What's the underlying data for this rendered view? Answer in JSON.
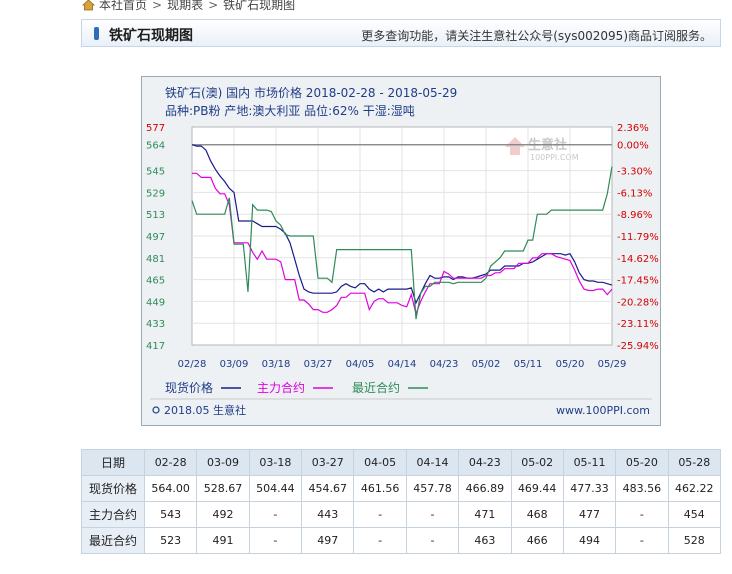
{
  "breadcrumb": [
    "本社首页",
    "现期表",
    "铁矿石现期图"
  ],
  "page_title": "铁矿石现期图",
  "notice": "更多查询功能，请关注生意社公众号(sys002095)商品订阅服务。",
  "chart_data": {
    "type": "line",
    "title": "铁矿石(澳) 国内 市场价格 2018-02-28 - 2018-05-29",
    "subtitle": "品种:PB粉 产地:澳大利亚 品位:62% 干湿:湿吨",
    "watermark_cn": "生意社",
    "watermark_url": "100PPI.COM",
    "footer_left": "2018.05 生意社",
    "footer_right": "www.100PPI.com",
    "grid": true,
    "legend_position": "bottom",
    "ylim": [
      417,
      577
    ],
    "left_ticks": [
      "577",
      "564",
      "545",
      "529",
      "513",
      "497",
      "481",
      "465",
      "449",
      "433",
      "417"
    ],
    "left_tick_values": [
      577,
      564,
      545,
      529,
      513,
      497,
      481,
      465,
      449,
      433,
      417
    ],
    "right_ticks": [
      "2.36%",
      "0.00%",
      "-3.30%",
      "-6.13%",
      "-8.96%",
      "-11.79%",
      "-14.62%",
      "-17.45%",
      "-20.28%",
      "-23.11%",
      "-25.94%"
    ],
    "x_ticks": [
      "02/28",
      "03/09",
      "03/18",
      "03/27",
      "04/05",
      "04/14",
      "04/23",
      "05/02",
      "05/11",
      "05/20",
      "05/29"
    ],
    "x_range": [
      "2018-02-28",
      "2018-05-29"
    ],
    "baseline_value": 564,
    "colors": {
      "spot": "#1a1a8c",
      "main": "#e000e0",
      "recent": "#2e8b57",
      "baseline": "#7d7d7d",
      "top_tick": "#d40000",
      "right_axis": "#d40000"
    },
    "series": [
      {
        "name": "现货价格",
        "color": "#1a1a8c",
        "points": [
          [
            "02-28",
            564
          ],
          [
            "03-01",
            563
          ],
          [
            "03-02",
            563
          ],
          [
            "03-03",
            560
          ],
          [
            "03-04",
            552
          ],
          [
            "03-05",
            546
          ],
          [
            "03-06",
            541
          ],
          [
            "03-07",
            537
          ],
          [
            "03-08",
            532
          ],
          [
            "03-09",
            529
          ],
          [
            "03-10",
            508
          ],
          [
            "03-11",
            508
          ],
          [
            "03-12",
            508
          ],
          [
            "03-13",
            508
          ],
          [
            "03-14",
            506
          ],
          [
            "03-15",
            504
          ],
          [
            "03-16",
            504
          ],
          [
            "03-17",
            504
          ],
          [
            "03-18",
            504
          ],
          [
            "03-19",
            502
          ],
          [
            "03-20",
            499
          ],
          [
            "03-21",
            492
          ],
          [
            "03-22",
            480
          ],
          [
            "03-23",
            468
          ],
          [
            "03-24",
            458
          ],
          [
            "03-25",
            456
          ],
          [
            "03-26",
            455
          ],
          [
            "03-27",
            455
          ],
          [
            "03-28",
            455
          ],
          [
            "03-29",
            455
          ],
          [
            "03-30",
            455
          ],
          [
            "03-31",
            456
          ],
          [
            "04-01",
            460
          ],
          [
            "04-02",
            462
          ],
          [
            "04-03",
            460
          ],
          [
            "04-04",
            459
          ],
          [
            "04-05",
            462
          ],
          [
            "04-06",
            462
          ],
          [
            "04-07",
            458
          ],
          [
            "04-08",
            456
          ],
          [
            "04-09",
            458
          ],
          [
            "04-10",
            456
          ],
          [
            "04-11",
            458
          ],
          [
            "04-12",
            458
          ],
          [
            "04-13",
            458
          ],
          [
            "04-14",
            458
          ],
          [
            "04-15",
            458
          ],
          [
            "04-16",
            459
          ],
          [
            "04-17",
            448
          ],
          [
            "04-18",
            455
          ],
          [
            "04-19",
            462
          ],
          [
            "04-20",
            468
          ],
          [
            "04-21",
            466
          ],
          [
            "04-22",
            466
          ],
          [
            "04-23",
            467
          ],
          [
            "04-24",
            467
          ],
          [
            "04-25",
            465
          ],
          [
            "04-26",
            467
          ],
          [
            "04-27",
            467
          ],
          [
            "04-28",
            466
          ],
          [
            "04-29",
            466
          ],
          [
            "04-30",
            467
          ],
          [
            "05-01",
            468
          ],
          [
            "05-02",
            469
          ],
          [
            "05-03",
            472
          ],
          [
            "05-04",
            472
          ],
          [
            "05-05",
            472
          ],
          [
            "05-06",
            475
          ],
          [
            "05-07",
            475
          ],
          [
            "05-08",
            475
          ],
          [
            "05-09",
            475
          ],
          [
            "05-10",
            477
          ],
          [
            "05-11",
            477
          ],
          [
            "05-12",
            478
          ],
          [
            "05-13",
            480
          ],
          [
            "05-14",
            482
          ],
          [
            "05-15",
            484
          ],
          [
            "05-16",
            484
          ],
          [
            "05-17",
            484
          ],
          [
            "05-18",
            484
          ],
          [
            "05-19",
            483
          ],
          [
            "05-20",
            484
          ],
          [
            "05-21",
            478
          ],
          [
            "05-22",
            470
          ],
          [
            "05-23",
            465
          ],
          [
            "05-24",
            464
          ],
          [
            "05-25",
            464
          ],
          [
            "05-26",
            463
          ],
          [
            "05-27",
            463
          ],
          [
            "05-28",
            462
          ],
          [
            "05-29",
            461
          ]
        ]
      },
      {
        "name": "主力合约",
        "color": "#e000e0",
        "points": [
          [
            "02-28",
            543
          ],
          [
            "03-01",
            543
          ],
          [
            "03-02",
            540
          ],
          [
            "03-03",
            540
          ],
          [
            "03-04",
            540
          ],
          [
            "03-05",
            532
          ],
          [
            "03-06",
            528
          ],
          [
            "03-07",
            528
          ],
          [
            "03-08",
            520
          ],
          [
            "03-09",
            492
          ],
          [
            "03-10",
            492
          ],
          [
            "03-11",
            492
          ],
          [
            "03-12",
            492
          ],
          [
            "03-13",
            485
          ],
          [
            "03-14",
            480
          ],
          [
            "03-15",
            486
          ],
          [
            "03-16",
            480
          ],
          [
            "03-17",
            480
          ],
          [
            "03-18",
            480
          ],
          [
            "03-19",
            478
          ],
          [
            "03-20",
            465
          ],
          [
            "03-21",
            465
          ],
          [
            "03-22",
            465
          ],
          [
            "03-23",
            450
          ],
          [
            "03-24",
            450
          ],
          [
            "03-25",
            447
          ],
          [
            "03-26",
            443
          ],
          [
            "03-27",
            443
          ],
          [
            "03-28",
            441
          ],
          [
            "03-29",
            441
          ],
          [
            "03-30",
            443
          ],
          [
            "03-31",
            446
          ],
          [
            "04-01",
            452
          ],
          [
            "04-02",
            452
          ],
          [
            "04-03",
            455
          ],
          [
            "04-04",
            455
          ],
          [
            "04-05",
            455
          ],
          [
            "04-06",
            455
          ],
          [
            "04-07",
            443
          ],
          [
            "04-08",
            449
          ],
          [
            "04-09",
            451
          ],
          [
            "04-10",
            451
          ],
          [
            "04-11",
            448
          ],
          [
            "04-12",
            448
          ],
          [
            "04-13",
            448
          ],
          [
            "04-14",
            446
          ],
          [
            "04-15",
            445
          ],
          [
            "04-16",
            454
          ],
          [
            "04-17",
            440
          ],
          [
            "04-18",
            449
          ],
          [
            "04-19",
            456
          ],
          [
            "04-20",
            462
          ],
          [
            "04-21",
            462
          ],
          [
            "04-22",
            462
          ],
          [
            "04-23",
            471
          ],
          [
            "04-24",
            469
          ],
          [
            "04-25",
            466
          ],
          [
            "04-26",
            466
          ],
          [
            "04-27",
            466
          ],
          [
            "04-28",
            466
          ],
          [
            "04-29",
            466
          ],
          [
            "04-30",
            466
          ],
          [
            "05-01",
            466
          ],
          [
            "05-02",
            468
          ],
          [
            "05-03",
            468
          ],
          [
            "05-04",
            470
          ],
          [
            "05-05",
            470
          ],
          [
            "05-06",
            473
          ],
          [
            "05-07",
            473
          ],
          [
            "05-08",
            473
          ],
          [
            "05-09",
            477
          ],
          [
            "05-10",
            477
          ],
          [
            "05-11",
            477
          ],
          [
            "05-12",
            481
          ],
          [
            "05-13",
            481
          ],
          [
            "05-14",
            484
          ],
          [
            "05-15",
            484
          ],
          [
            "05-16",
            484
          ],
          [
            "05-17",
            482
          ],
          [
            "05-18",
            481
          ],
          [
            "05-19",
            480
          ],
          [
            "05-20",
            479
          ],
          [
            "05-21",
            472
          ],
          [
            "05-22",
            464
          ],
          [
            "05-23",
            458
          ],
          [
            "05-24",
            457
          ],
          [
            "05-25",
            457
          ],
          [
            "05-26",
            458
          ],
          [
            "05-27",
            458
          ],
          [
            "05-28",
            454
          ],
          [
            "05-29",
            458
          ]
        ]
      },
      {
        "name": "最近合约",
        "color": "#2e8b57",
        "points": [
          [
            "02-28",
            523
          ],
          [
            "03-01",
            513
          ],
          [
            "03-02",
            513
          ],
          [
            "03-03",
            513
          ],
          [
            "03-04",
            513
          ],
          [
            "03-05",
            513
          ],
          [
            "03-06",
            513
          ],
          [
            "03-07",
            513
          ],
          [
            "03-08",
            525
          ],
          [
            "03-09",
            491
          ],
          [
            "03-10",
            491
          ],
          [
            "03-11",
            491
          ],
          [
            "03-12",
            456
          ],
          [
            "03-13",
            520
          ],
          [
            "03-14",
            516
          ],
          [
            "03-15",
            516
          ],
          [
            "03-16",
            516
          ],
          [
            "03-17",
            515
          ],
          [
            "03-18",
            508
          ],
          [
            "03-19",
            505
          ],
          [
            "03-20",
            498
          ],
          [
            "03-21",
            497
          ],
          [
            "03-22",
            497
          ],
          [
            "03-23",
            497
          ],
          [
            "03-24",
            497
          ],
          [
            "03-25",
            497
          ],
          [
            "03-26",
            497
          ],
          [
            "03-27",
            466
          ],
          [
            "03-28",
            466
          ],
          [
            "03-29",
            466
          ],
          [
            "03-30",
            463
          ],
          [
            "03-31",
            487
          ],
          [
            "04-01",
            487
          ],
          [
            "04-02",
            487
          ],
          [
            "04-03",
            487
          ],
          [
            "04-04",
            487
          ],
          [
            "04-05",
            487
          ],
          [
            "04-06",
            487
          ],
          [
            "04-07",
            487
          ],
          [
            "04-08",
            487
          ],
          [
            "04-09",
            487
          ],
          [
            "04-10",
            487
          ],
          [
            "04-11",
            487
          ],
          [
            "04-12",
            487
          ],
          [
            "04-13",
            487
          ],
          [
            "04-14",
            487
          ],
          [
            "04-15",
            487
          ],
          [
            "04-16",
            487
          ],
          [
            "04-17",
            436
          ],
          [
            "04-18",
            455
          ],
          [
            "04-19",
            460
          ],
          [
            "04-20",
            460
          ],
          [
            "04-21",
            463
          ],
          [
            "04-22",
            463
          ],
          [
            "04-23",
            463
          ],
          [
            "04-24",
            463
          ],
          [
            "04-25",
            462
          ],
          [
            "04-26",
            463
          ],
          [
            "04-27",
            463
          ],
          [
            "04-28",
            463
          ],
          [
            "04-29",
            463
          ],
          [
            "04-30",
            463
          ],
          [
            "05-01",
            463
          ],
          [
            "05-02",
            466
          ],
          [
            "05-03",
            475
          ],
          [
            "05-04",
            478
          ],
          [
            "05-05",
            481
          ],
          [
            "05-06",
            486
          ],
          [
            "05-07",
            486
          ],
          [
            "05-08",
            486
          ],
          [
            "05-09",
            486
          ],
          [
            "05-10",
            486
          ],
          [
            "05-11",
            494
          ],
          [
            "05-12",
            494
          ],
          [
            "05-13",
            513
          ],
          [
            "05-14",
            513
          ],
          [
            "05-15",
            513
          ],
          [
            "05-16",
            516
          ],
          [
            "05-17",
            516
          ],
          [
            "05-18",
            516
          ],
          [
            "05-19",
            516
          ],
          [
            "05-20",
            516
          ],
          [
            "05-21",
            516
          ],
          [
            "05-22",
            516
          ],
          [
            "05-23",
            516
          ],
          [
            "05-24",
            516
          ],
          [
            "05-25",
            516
          ],
          [
            "05-26",
            516
          ],
          [
            "05-27",
            516
          ],
          [
            "05-28",
            528
          ],
          [
            "05-29",
            548
          ]
        ]
      }
    ]
  },
  "table": {
    "header_label": "日期",
    "dates": [
      "02-28",
      "03-09",
      "03-18",
      "03-27",
      "04-05",
      "04-14",
      "04-23",
      "05-02",
      "05-11",
      "05-20",
      "05-28"
    ],
    "rows": [
      {
        "label": "现货价格",
        "values": [
          "564.00",
          "528.67",
          "504.44",
          "454.67",
          "461.56",
          "457.78",
          "466.89",
          "469.44",
          "477.33",
          "483.56",
          "462.22"
        ]
      },
      {
        "label": "主力合约",
        "values": [
          "543",
          "492",
          "-",
          "443",
          "-",
          "-",
          "471",
          "468",
          "477",
          "-",
          "454"
        ]
      },
      {
        "label": "最近合约",
        "values": [
          "523",
          "491",
          "-",
          "497",
          "-",
          "-",
          "463",
          "466",
          "494",
          "-",
          "528"
        ]
      }
    ]
  }
}
